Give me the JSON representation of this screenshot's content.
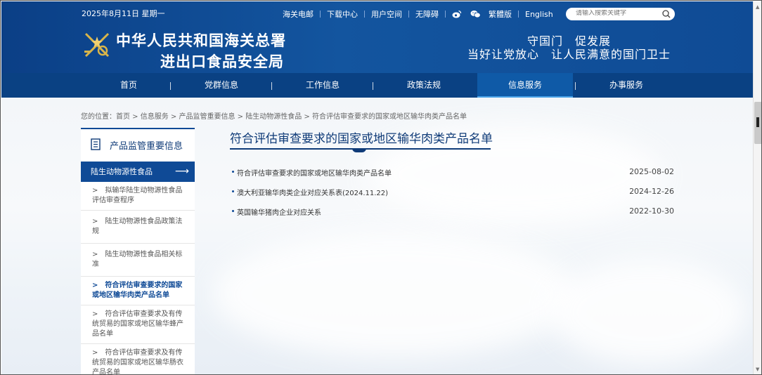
{
  "topbar": {
    "date": "2025年8月11日 星期一",
    "links": [
      "海关电邮",
      "下载中心",
      "用户空间",
      "无障碍"
    ],
    "social": [
      "weibo-icon",
      "wechat-icon"
    ],
    "lang_links": [
      "繁體版",
      "English"
    ],
    "search_placeholder": "请输入搜索关键字"
  },
  "header": {
    "org_line1": "中华人民共和国海关总署",
    "org_line2": "进出口食品安全局",
    "slogan1": "守国门　促发展",
    "slogan2": "当好让党放心　让人民满意的国门卫士"
  },
  "nav": {
    "items": [
      "首页",
      "党群信息",
      "工作信息",
      "政策法规",
      "信息服务",
      "办事服务"
    ],
    "active_index": 4
  },
  "breadcrumb": "您的位置：首页 > 信息服务 > 产品监管重要信息 > 陆生动物源性食品 > 符合评估审查要求的国家或地区输华肉类产品名单",
  "sidebar": {
    "title": "产品监管重要信息",
    "active_category": "陆生动物源性食品",
    "items": [
      ">　拟输华陆生动物源性食品评估审查程序",
      ">　陆生动物源性食品政策法规",
      ">　陆生动物源性食品相关标准",
      ">　符合评估审查要求的国家或地区输华肉类产品名单",
      ">　符合评估审查要求及有传统贸易的国家或地区输华蜂产品名单",
      ">　符合评估审查要求及有传统贸易的国家或地区输华肠衣产品名单"
    ],
    "selected_index": 3
  },
  "main": {
    "title": "符合评估审查要求的国家或地区输华肉类产品名单",
    "articles": [
      {
        "title": "符合评估审查要求的国家或地区输华肉类产品名单",
        "date": "2025-08-02"
      },
      {
        "title": "澳大利亚输华肉类企业对应关系表(2024.11.22)",
        "date": "2024-12-26"
      },
      {
        "title": "英国输华猪肉企业对应关系",
        "date": "2022-10-30"
      }
    ]
  },
  "colors": {
    "header_blue": "#0f4a96",
    "nav_blue": "#0a4183",
    "title_blue": "#0f3b78"
  }
}
